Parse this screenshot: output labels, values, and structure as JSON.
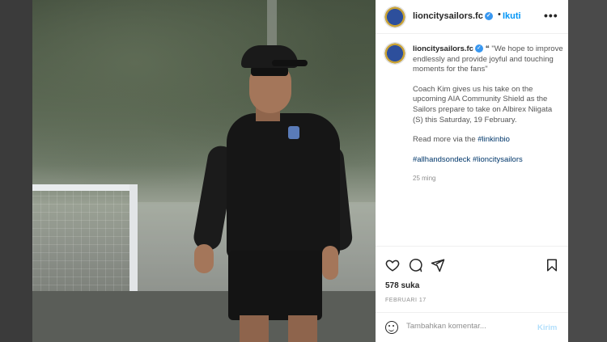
{
  "header": {
    "username": "lioncitysailors.fc",
    "separator": "•",
    "follow_label": "Ikuti",
    "more_icon": "more-horizontal-icon"
  },
  "caption": {
    "username": "lioncitysailors.fc",
    "quote": "\"We hope to improve endlessly and provide joyful and touching moments for the fans\"",
    "paragraph": "Coach Kim gives us his take on the upcoming AIA Community Shield as the Sailors prepare to take on Albirex Niigata (S) this Saturday, 19 February.",
    "read_more_prefix": "Read more via the ",
    "read_more_tag": "#linkinbio",
    "hashtag_1": "#allhandsondeck",
    "hashtag_2": "#lioncitysailors",
    "timestamp": "25 ming"
  },
  "actions": {
    "like_icon": "heart-icon",
    "comment_icon": "comment-icon",
    "share_icon": "send-icon",
    "save_icon": "bookmark-icon"
  },
  "likes": "578 suka",
  "date": "FEBRUARI 17",
  "comment": {
    "placeholder": "Tambahkan komentar...",
    "post_label": "Kirim"
  },
  "colors": {
    "link_blue": "#0095f6",
    "hashtag": "#00376b",
    "verified": "#3897f0",
    "post_disabled": "#b2dffc"
  }
}
